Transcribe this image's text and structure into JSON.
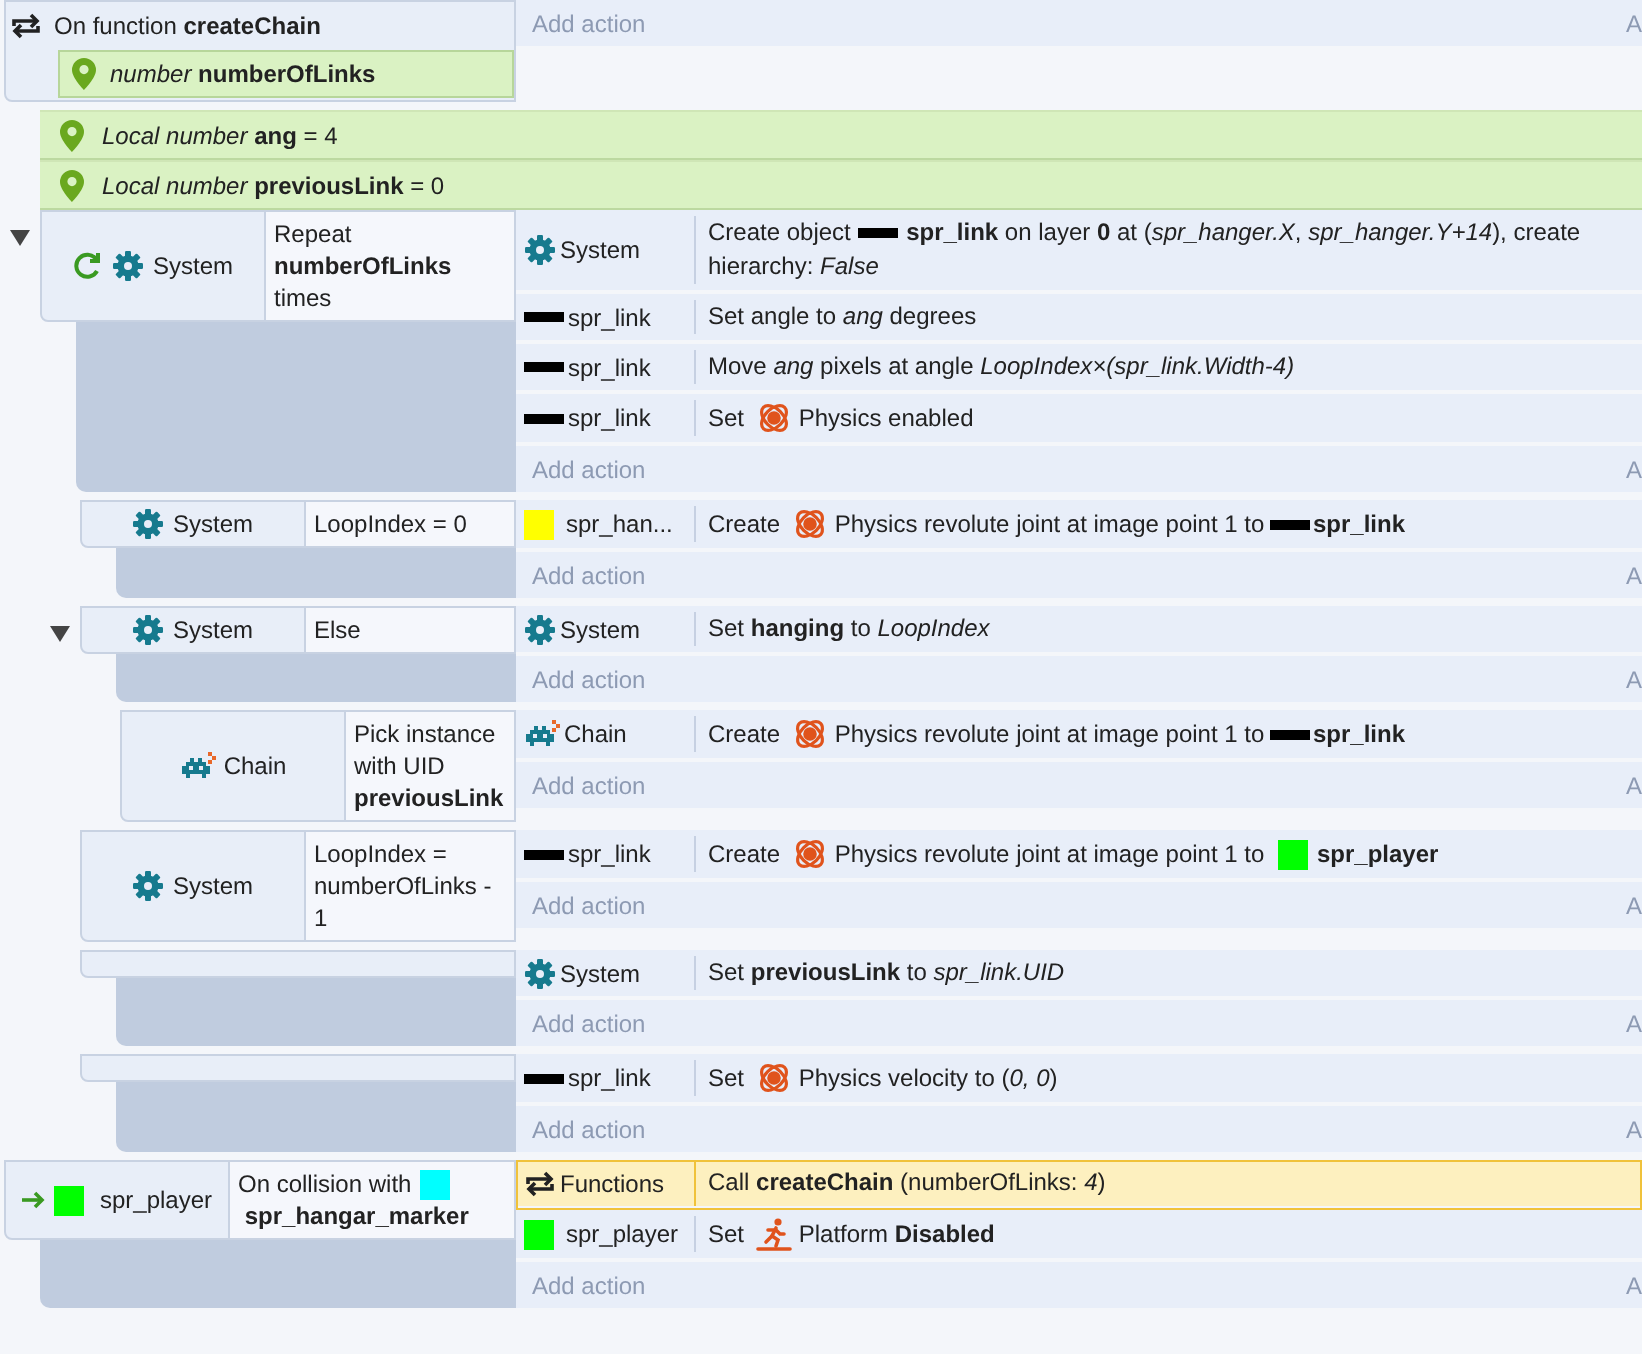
{
  "events": [
    {
      "kind": "function",
      "trigger": "On function **createChain**",
      "params": [
        {
          "text": "*number* **numberOfLinks**"
        }
      ],
      "add_action": "Add action",
      "add_action_edge": "A",
      "children": [
        {
          "kind": "local",
          "text": "*Local number* **ang** = 4"
        },
        {
          "kind": "local",
          "text": "*Local number* **previousLink** = 0"
        },
        {
          "kind": "event",
          "expanded": true,
          "repeat": true,
          "conditions": [
            {
              "object": {
                "kind": "system",
                "name": "System"
              },
              "text": "Repeat **numberOfLinks** times"
            }
          ],
          "actions": [
            {
              "selected": false,
              "object": {
                "kind": "system",
                "name": "System"
              },
              "segments": [
                {
                  "kind": "text",
                  "text": "Create object "
                },
                {
                  "kind": "sprite-bar",
                  "color": "#000000"
                },
                {
                  "kind": "text",
                  "text": " **spr_link** on layer **0** at (*spr_hanger.X*, *spr_hanger.Y+14*), create"
                },
                {
                  "kind": "text",
                  "text": "hierarchy: *False*"
                }
              ]
            },
            {
              "selected": false,
              "object": {
                "kind": "sprite-bar",
                "color": "#000000",
                "name": "spr_link"
              },
              "segments": [
                {
                  "kind": "text",
                  "text": "Set angle to *ang* degrees"
                }
              ]
            },
            {
              "selected": false,
              "object": {
                "kind": "sprite-bar",
                "color": "#000000",
                "name": "spr_link"
              },
              "segments": [
                {
                  "kind": "text",
                  "text": "Move *ang* pixels at angle *LoopIndex×(spr_link.Width-4)*"
                }
              ]
            },
            {
              "selected": false,
              "object": {
                "kind": "sprite-bar",
                "color": "#000000",
                "name": "spr_link"
              },
              "segments": [
                {
                  "kind": "text",
                  "text": "Set "
                },
                {
                  "kind": "physics"
                },
                {
                  "kind": "text",
                  "text": "Physics enabled"
                }
              ]
            }
          ],
          "add_action": "Add action",
          "add_action_edge": "A",
          "children": [
            {
              "kind": "event",
              "conditions": [
                {
                  "object": {
                    "kind": "system",
                    "name": "System"
                  },
                  "text": "LoopIndex = 0"
                }
              ],
              "actions": [
                {
                  "selected": false,
                  "object": {
                    "kind": "sprite",
                    "color": "#ffff00",
                    "name": "spr_han..."
                  },
                  "segments": [
                    {
                      "kind": "text",
                      "text": "Create "
                    },
                    {
                      "kind": "physics"
                    },
                    {
                      "kind": "text",
                      "text": "Physics revolute joint at image point 1 to "
                    },
                    {
                      "kind": "sprite-bar",
                      "color": "#000000"
                    },
                    {
                      "kind": "text",
                      "text": "**spr_link**"
                    }
                  ]
                }
              ],
              "add_action": "Add action",
              "add_action_edge": "A"
            },
            {
              "kind": "event",
              "expanded": true,
              "conditions": [
                {
                  "object": {
                    "kind": "system",
                    "name": "System"
                  },
                  "text": "Else"
                }
              ],
              "actions": [
                {
                  "selected": false,
                  "object": {
                    "kind": "system",
                    "name": "System"
                  },
                  "segments": [
                    {
                      "kind": "text",
                      "text": "Set **hanging** to *LoopIndex*"
                    }
                  ]
                }
              ],
              "add_action": "Add action",
              "add_action_edge": "A",
              "children": [
                {
                  "kind": "event",
                  "conditions": [
                    {
                      "object": {
                        "kind": "family",
                        "name": "Chain"
                      },
                      "text": "Pick instance with UID **previousLink**"
                    }
                  ],
                  "actions": [
                    {
                      "selected": false,
                      "object": {
                        "kind": "family",
                        "name": "Chain"
                      },
                      "segments": [
                        {
                          "kind": "text",
                          "text": "Create "
                        },
                        {
                          "kind": "physics"
                        },
                        {
                          "kind": "text",
                          "text": "Physics revolute joint at image point 1 to "
                        },
                        {
                          "kind": "sprite-bar",
                          "color": "#000000"
                        },
                        {
                          "kind": "text",
                          "text": "**spr_link**"
                        }
                      ]
                    }
                  ],
                  "add_action": "Add action",
                  "add_action_edge": "A"
                }
              ]
            },
            {
              "kind": "event",
              "conditions": [
                {
                  "object": {
                    "kind": "system",
                    "name": "System"
                  },
                  "text": "LoopIndex = numberOfLinks - 1"
                }
              ],
              "actions": [
                {
                  "selected": false,
                  "object": {
                    "kind": "sprite-bar",
                    "color": "#000000",
                    "name": "spr_link"
                  },
                  "segments": [
                    {
                      "kind": "text",
                      "text": "Create "
                    },
                    {
                      "kind": "physics"
                    },
                    {
                      "kind": "text",
                      "text": "Physics revolute joint at image point 1 to "
                    },
                    {
                      "kind": "sprite",
                      "color": "#00ff00"
                    },
                    {
                      "kind": "text",
                      "text": "**spr_player**"
                    }
                  ]
                }
              ],
              "add_action": "Add action",
              "add_action_edge": "A"
            },
            {
              "kind": "event",
              "actions": [
                {
                  "selected": false,
                  "object": {
                    "kind": "system",
                    "name": "System"
                  },
                  "segments": [
                    {
                      "kind": "text",
                      "text": "Set **previousLink** to *spr_link.UID*"
                    }
                  ]
                }
              ],
              "add_action": "Add action",
              "add_action_edge": "A"
            },
            {
              "kind": "event",
              "actions": [
                {
                  "selected": false,
                  "object": {
                    "kind": "sprite-bar",
                    "color": "#000000",
                    "name": "spr_link"
                  },
                  "segments": [
                    {
                      "kind": "text",
                      "text": "Set "
                    },
                    {
                      "kind": "physics"
                    },
                    {
                      "kind": "text",
                      "text": "Physics velocity to (*0, 0*)"
                    }
                  ]
                }
              ],
              "add_action": "Add action",
              "add_action_edge": "A"
            }
          ]
        }
      ]
    },
    {
      "kind": "event",
      "trigger": true,
      "conditions": [
        {
          "object": {
            "kind": "sprite",
            "color": "#00ff00",
            "name": "spr_player"
          },
          "segments": [
            {
              "kind": "text",
              "text": "On collision with "
            },
            {
              "kind": "sprite",
              "color": "#00ffff"
            },
            {
              "kind": "text",
              "text": " **spr_hangar_marker**"
            }
          ]
        }
      ],
      "actions": [
        {
          "selected": true,
          "object": {
            "kind": "functions",
            "name": "Functions"
          },
          "segments": [
            {
              "kind": "text",
              "text": "Call **createChain** (numberOfLinks: *4*)"
            }
          ]
        },
        {
          "selected": false,
          "object": {
            "kind": "sprite",
            "color": "#00ff00",
            "name": "spr_player"
          },
          "segments": [
            {
              "kind": "text",
              "text": "Set "
            },
            {
              "kind": "platform"
            },
            {
              "kind": "text",
              "text": "Platform **Disabled**"
            }
          ]
        }
      ],
      "add_action": "Add action",
      "add_action_edge": "A"
    }
  ]
}
